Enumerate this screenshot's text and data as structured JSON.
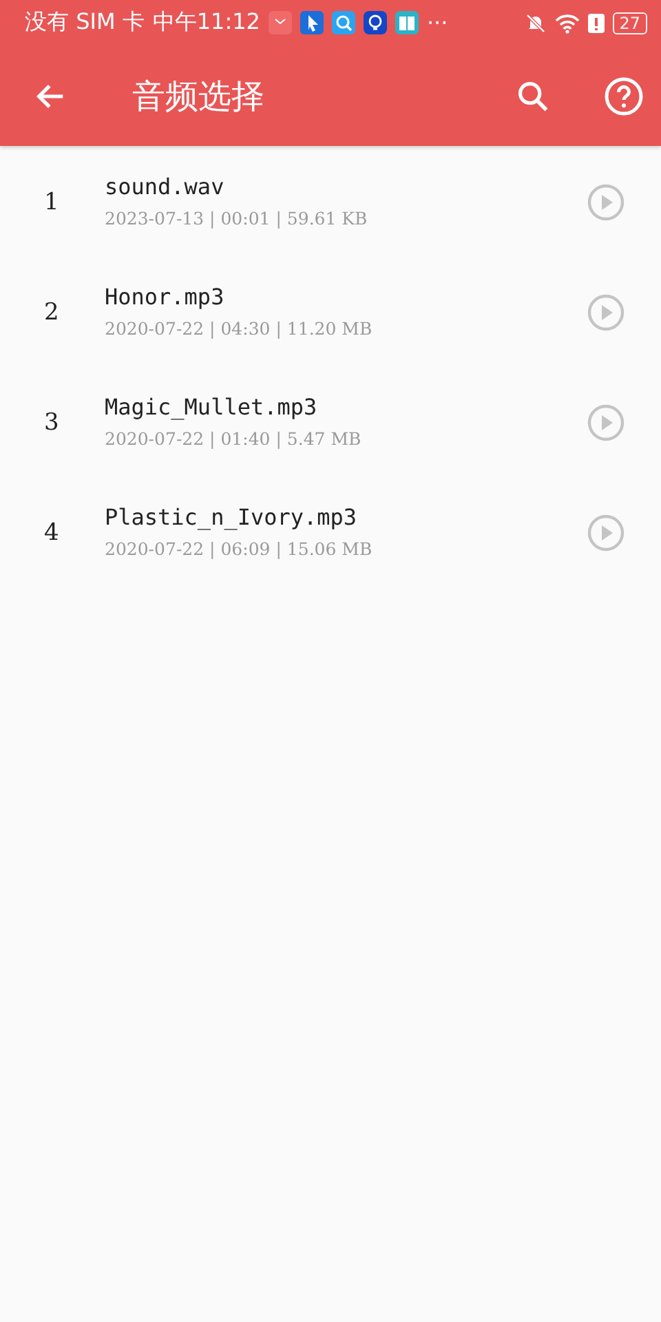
{
  "status_bar": {
    "carrier": "没有 SIM 卡",
    "time": "中午11:12",
    "more": "···",
    "battery": "27"
  },
  "app_bar": {
    "title": "音频选择"
  },
  "files": [
    {
      "index": "1",
      "name": "sound.wav",
      "meta": "2023-07-13 | 00:01 | 59.61 KB"
    },
    {
      "index": "2",
      "name": "Honor.mp3",
      "meta": "2020-07-22 | 04:30 | 11.20 MB"
    },
    {
      "index": "3",
      "name": "Magic_Mullet.mp3",
      "meta": "2020-07-22 | 01:40 | 5.47 MB"
    },
    {
      "index": "4",
      "name": "Plastic_n_Ivory.mp3",
      "meta": "2020-07-22 | 06:09 | 15.06 MB"
    }
  ]
}
